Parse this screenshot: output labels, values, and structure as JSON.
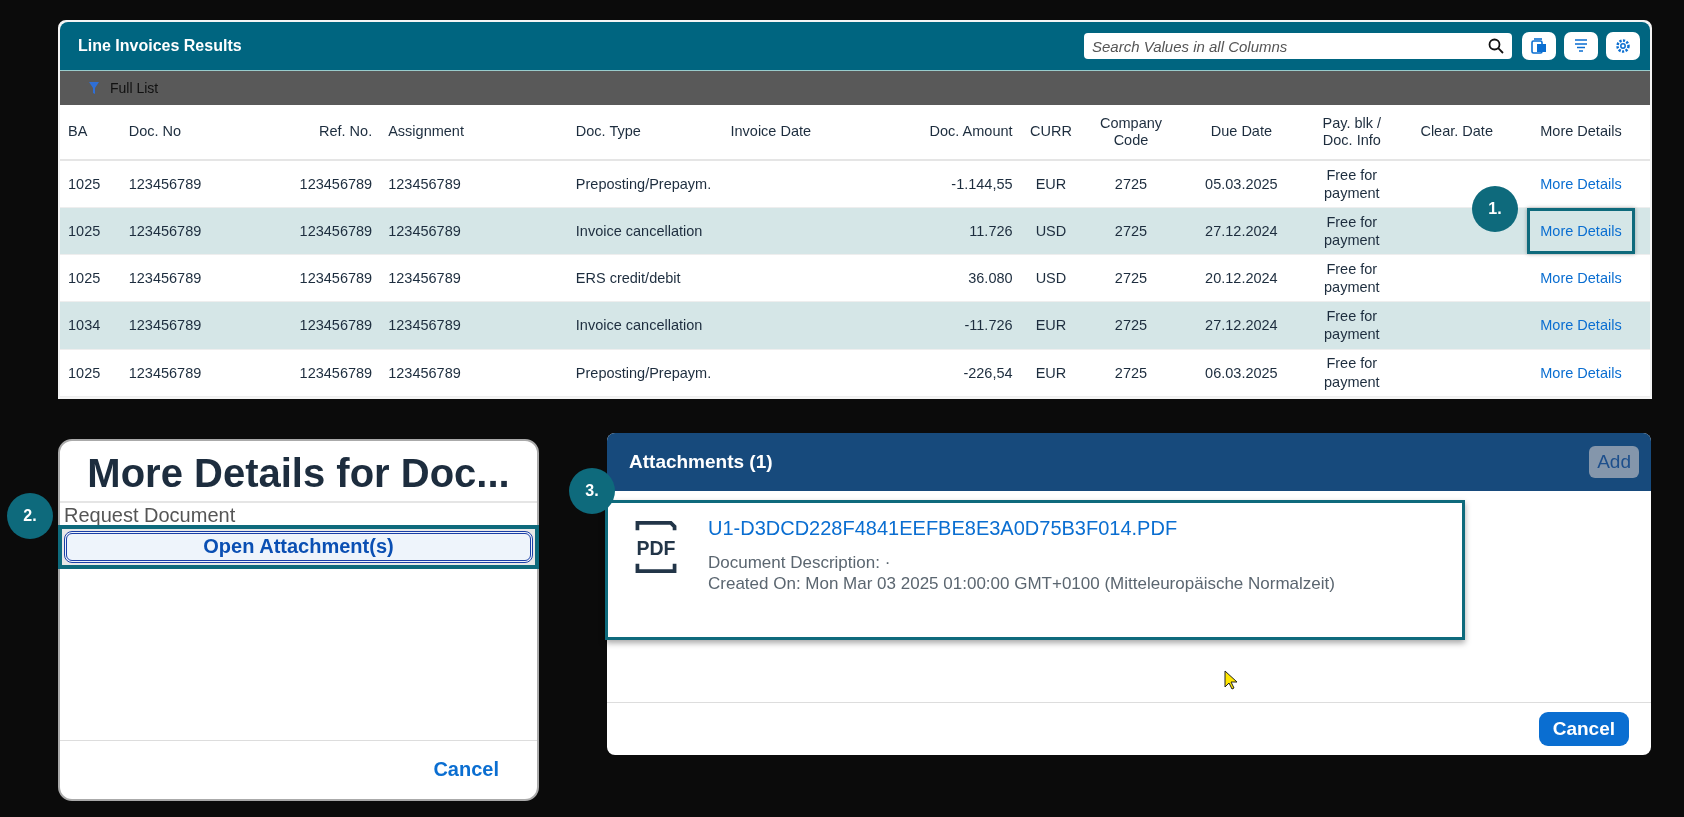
{
  "results": {
    "title": "Line Invoices Results",
    "search": {
      "placeholder": "Search Values in all Columns"
    },
    "variant": "Full List",
    "columns": [
      "BA",
      "Doc. No",
      "Ref. No.",
      "Assignment",
      "Doc. Type",
      "Invoice Date",
      "Doc. Amount",
      "CURR",
      "Company Code",
      "Due Date",
      "Pay. blk / Doc. Info",
      "Clear. Date",
      "More Details"
    ],
    "rows": [
      {
        "cells": [
          "1025",
          "123456789",
          "123456789",
          "123456789",
          "Preposting/Prepaym.",
          "",
          "-1.144,55",
          "EUR",
          "2725",
          "05.03.2025",
          "Free for payment",
          ""
        ],
        "link": "More Details",
        "highlighted": false
      },
      {
        "cells": [
          "1025",
          "123456789",
          "123456789",
          "123456789",
          "Invoice cancellation",
          "",
          "11.726",
          "USD",
          "2725",
          "27.12.2024",
          "Free for payment",
          ""
        ],
        "link": "More Details",
        "highlighted": true,
        "callout": "1."
      },
      {
        "cells": [
          "1025",
          "123456789",
          "123456789",
          "123456789",
          "ERS credit/debit",
          "",
          "36.080",
          "USD",
          "2725",
          "20.12.2024",
          "Free for payment",
          ""
        ],
        "link": "More Details",
        "highlighted": false
      },
      {
        "cells": [
          "1034",
          "123456789",
          "123456789",
          "123456789",
          "Invoice cancellation",
          "",
          "-11.726",
          "EUR",
          "2725",
          "27.12.2024",
          "Free for payment",
          ""
        ],
        "link": "More Details",
        "highlighted": false
      },
      {
        "cells": [
          "1025",
          "123456789",
          "123456789",
          "123456789",
          "Preposting/Prepaym.",
          "",
          "-226,54",
          "EUR",
          "2725",
          "06.03.2025",
          "Free for payment",
          ""
        ],
        "link": "More Details",
        "highlighted": false
      }
    ]
  },
  "details_dialog": {
    "title": "More Details for Doc...",
    "option": "Request Document",
    "button": {
      "label": "Open Attachment(s)",
      "callout": "2."
    },
    "cancel": "Cancel"
  },
  "attachments_dialog": {
    "title": "Attachments (1)",
    "add": {
      "label": "Add",
      "disabled": true
    },
    "items": [
      {
        "icon_label": "PDF",
        "name": "U1-D3DCD228F4841EEFBE8E3A0D75B3F014.PDF",
        "description": "Document Description: ·",
        "created": "Created On: Mon Mar 03 2025 01:00:00 GMT+0100 (Mitteleuropäische Normalzeit)",
        "callout": "3."
      }
    ],
    "cancel": "Cancel"
  }
}
